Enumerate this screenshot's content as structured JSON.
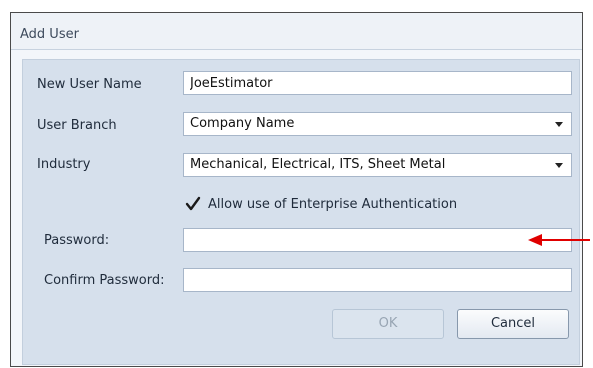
{
  "dialog": {
    "title": "Add User"
  },
  "form": {
    "new_user_name_label": "New User Name",
    "new_user_name_value": "JoeEstimator",
    "user_branch_label": "User Branch",
    "user_branch_value": "Company Name",
    "industry_label": "Industry",
    "industry_value": "Mechanical, Electrical, ITS, Sheet Metal",
    "enterprise_auth_label": "Allow use of Enterprise Authentication",
    "enterprise_auth_checked": true,
    "password_label": "Password:",
    "password_value": "",
    "confirm_password_label": "Confirm Password:",
    "confirm_password_value": ""
  },
  "buttons": {
    "ok_label": "OK",
    "ok_enabled": false,
    "cancel_label": "Cancel"
  },
  "annotation": {
    "arrow_color": "#e00000",
    "arrow_icon": "left-arrow-icon"
  },
  "colors": {
    "panel": "#d6e0ec",
    "border": "#a7b6c9"
  }
}
